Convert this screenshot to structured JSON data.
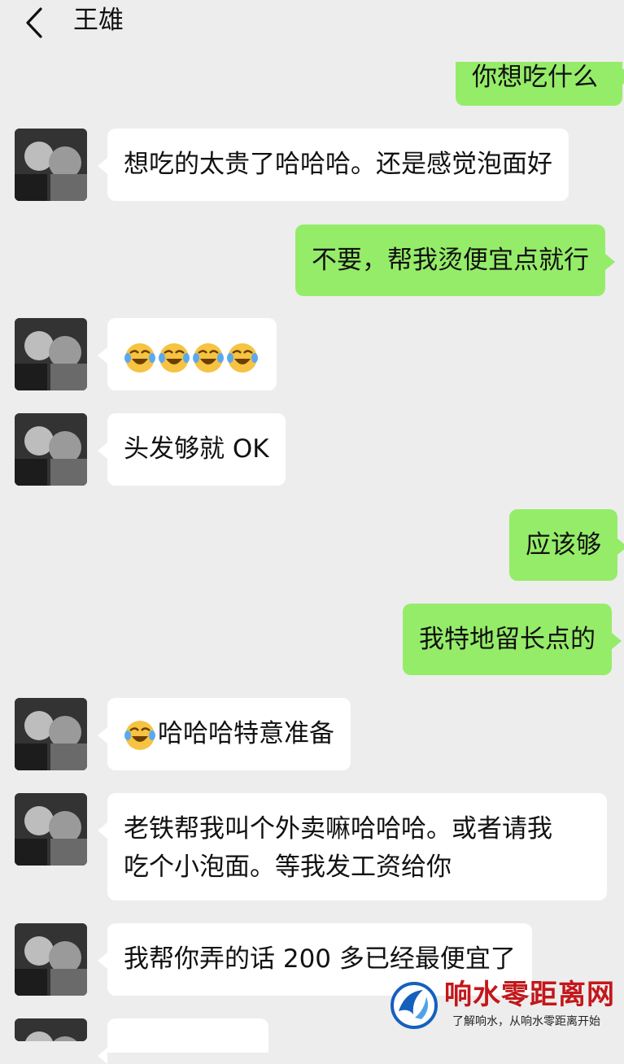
{
  "header": {
    "title": "王雄",
    "back_icon": "chevron-left-icon"
  },
  "messages": [
    {
      "side": "out",
      "text": "你想吃什么"
    },
    {
      "side": "in",
      "text": "想吃的太贵了哈哈哈。还是感觉泡面好"
    },
    {
      "side": "out",
      "text": "不要，帮我烫便宜点就行"
    },
    {
      "side": "in",
      "emoji": "face-with-tears-of-joy",
      "emoji_count": 4
    },
    {
      "side": "in",
      "text": "头发够就 OK"
    },
    {
      "side": "out",
      "text": "应该够"
    },
    {
      "side": "out",
      "text": "我特地留长点的"
    },
    {
      "side": "in",
      "emoji": "face-with-tears-of-joy",
      "text": "哈哈哈特意准备"
    },
    {
      "side": "in",
      "line1": "老铁帮我叫个外卖嘛哈哈哈。或者请我",
      "line2": "吃个小泡面。等我发工资给你"
    },
    {
      "side": "in",
      "text": "我帮你弄的话 200 多已经最便宜了"
    },
    {
      "side": "in",
      "text": ""
    }
  ],
  "watermark": {
    "name": "响水零距离网",
    "slogan": "了解响水，从响水零距离开始"
  },
  "colors": {
    "background": "#ededed",
    "bubble_out": "#95ec69",
    "bubble_in": "#ffffff",
    "watermark_red": "#c3171a"
  }
}
